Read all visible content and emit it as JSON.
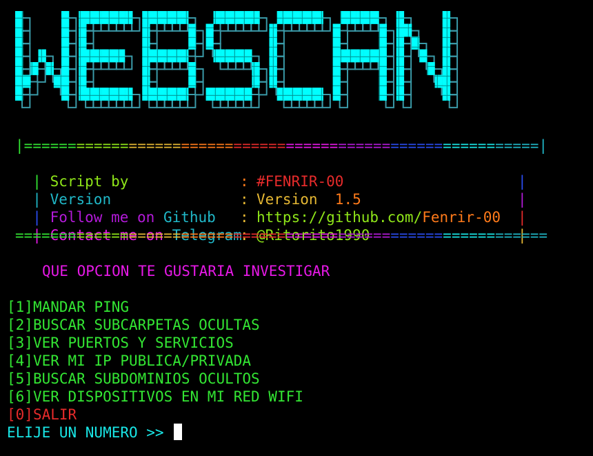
{
  "banner": {
    "text": "WEBSCAN",
    "fill_color": "#00ffff",
    "shadow_color": "#3a9aa8"
  },
  "info_box": {
    "top_border": "|===========================================================|",
    "bottom_border": "=============================================================",
    "rows": [
      {
        "label": "Script by",
        "sep": ":",
        "value": "#FENRIR-00"
      },
      {
        "label": "Version",
        "sep": ":",
        "value": "Version  1.5"
      },
      {
        "label": "Follow me on Github",
        "sep": ":",
        "value": "https://github.com/Fenrir-00"
      },
      {
        "label": "Contact me on Telegram",
        "sep": ":",
        "value": "@Ritorito1990"
      }
    ]
  },
  "question": "QUE OPCION TE GUSTARIA INVESTIGAR",
  "menu": [
    {
      "key": "[1]",
      "label": "MANDAR PING"
    },
    {
      "key": "[2]",
      "label": "BUSCAR SUBCARPETAS OCULTAS"
    },
    {
      "key": "[3]",
      "label": "VER PUERTOS Y SERVICIOS"
    },
    {
      "key": "[4]",
      "label": "VER MI IP PUBLICA/PRIVADA"
    },
    {
      "key": "[5]",
      "label": "BUSCAR SUBDOMINIOS OCULTOS"
    },
    {
      "key": "[6]",
      "label": "VER DISPOSITIVOS EN MI RED WIFI"
    },
    {
      "key": "[0]",
      "label": "SALIR"
    }
  ],
  "prompt": "ELIJE UN NUMERO >> ",
  "colors": {
    "cyan": "#19e6e6",
    "green": "#33e633",
    "red": "#e62b2b",
    "magenta": "#e619e6"
  }
}
